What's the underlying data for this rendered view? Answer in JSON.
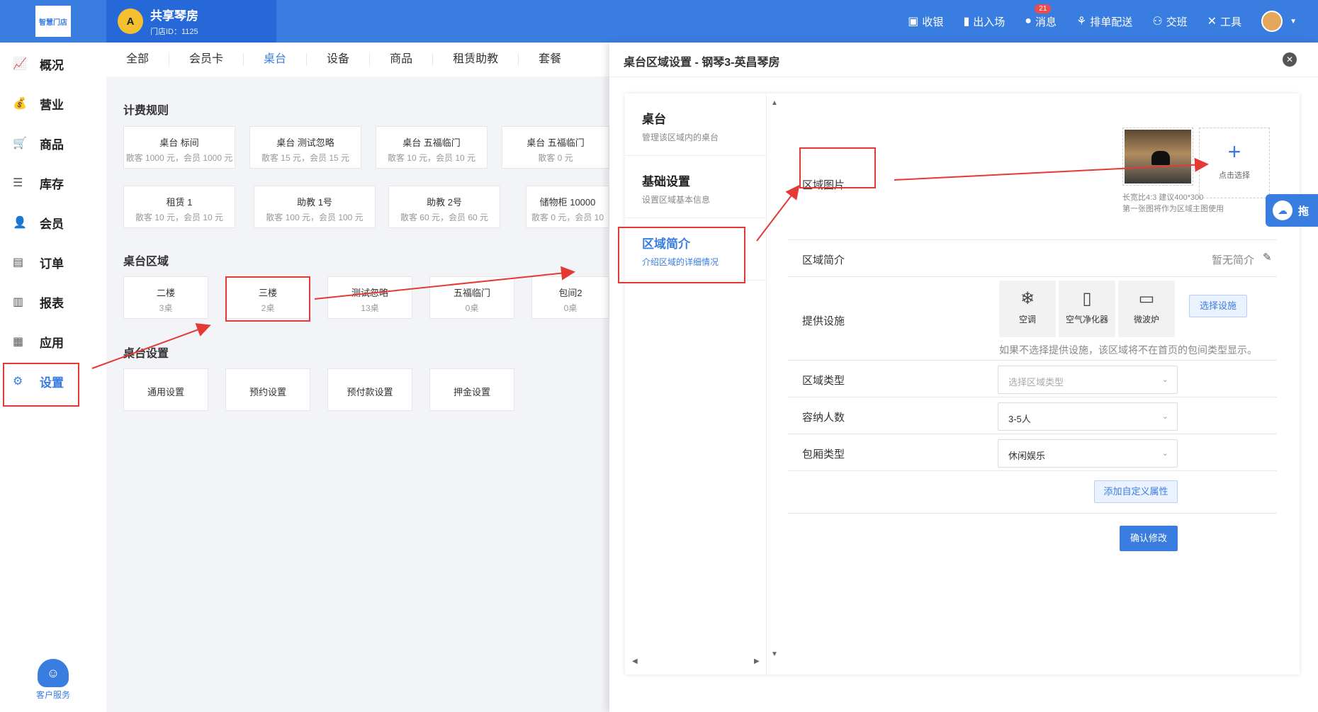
{
  "header": {
    "logo_text": "智慧门店",
    "store_avatar_text": "A",
    "store_name": "共享琴房",
    "store_id": "门店ID：1125",
    "actions": [
      {
        "label": "收银",
        "icon": "cash-register-icon"
      },
      {
        "label": "出入场",
        "icon": "door-icon"
      },
      {
        "label": "消息",
        "icon": "bell-icon"
      },
      {
        "label": "排单配送",
        "icon": "delivery-icon"
      },
      {
        "label": "交班",
        "icon": "shift-handover-icon"
      },
      {
        "label": "工具",
        "icon": "tools-icon"
      }
    ],
    "message_count": "21"
  },
  "sidebar": {
    "items": [
      {
        "label": "概况",
        "icon": "chart-line-icon"
      },
      {
        "label": "营业",
        "icon": "money-bag-icon"
      },
      {
        "label": "商品",
        "icon": "cart-icon"
      },
      {
        "label": "库存",
        "icon": "layers-icon"
      },
      {
        "label": "会员",
        "icon": "user-icon"
      },
      {
        "label": "订单",
        "icon": "order-icon"
      },
      {
        "label": "报表",
        "icon": "bar-chart-icon"
      },
      {
        "label": "应用",
        "icon": "apps-icon"
      },
      {
        "label": "设置",
        "icon": "gear-icon"
      }
    ],
    "active_index": 8,
    "customer_service": "客户服务"
  },
  "main": {
    "tabs": [
      "全部",
      "会员卡",
      "桌台",
      "设备",
      "商品",
      "租赁助教",
      "套餐"
    ],
    "active_tab": "桌台",
    "billing_title": "计费规则",
    "billing_row1": [
      {
        "name": "桌台 标间",
        "price": "散客 1000 元，会员 1000 元"
      },
      {
        "name": "桌台 测试忽略",
        "price": "散客 15 元，会员 15 元"
      },
      {
        "name": "桌台 五福临门",
        "price": "散客 10 元，会员 10 元"
      },
      {
        "name": "桌台 五福临门",
        "price": "散客 0 元"
      }
    ],
    "billing_row2": [
      {
        "name": "租赁 1",
        "price": "散客 10 元，会员 10 元"
      },
      {
        "name": "助教 1号",
        "price": "散客 100 元，会员 100 元"
      },
      {
        "name": "助教 2号",
        "price": "散客 60 元，会员 60 元"
      },
      {
        "name": "储物柜 10000",
        "price": "散客 0 元，会员 10"
      }
    ],
    "area_title": "桌台区域",
    "areas": [
      {
        "name": "二楼",
        "count": "3桌"
      },
      {
        "name": "三楼",
        "count": "2桌"
      },
      {
        "name": "测试忽略",
        "count": "13桌"
      },
      {
        "name": "五福临门",
        "count": "0桌"
      },
      {
        "name": "包间2",
        "count": "0桌"
      }
    ],
    "settings_title": "桌台设置",
    "settings": [
      "通用设置",
      "预约设置",
      "预付款设置",
      "押金设置"
    ]
  },
  "panel": {
    "title": "桌台区域设置 - 钢琴3-英昌琴房",
    "close_icon": "close-icon",
    "subnav": [
      {
        "title": "桌台",
        "desc": "管理该区域内的桌台"
      },
      {
        "title": "基础设置",
        "desc": "设置区域基本信息"
      },
      {
        "title": "区域简介",
        "desc": "介绍区域的详细情况"
      }
    ],
    "active_subnav": 2,
    "form": {
      "image_label": "区域图片",
      "upload_text": "点击选择",
      "image_hint1": "长宽比4:3 建议400*300",
      "image_hint2": "第一张图将作为区域主图使用",
      "intro_label": "区域简介",
      "intro_value": "暂无简介",
      "facilities_label": "提供设施",
      "facilities": [
        {
          "label": "空调",
          "icon": "snowflake-icon",
          "glyph": "❄"
        },
        {
          "label": "空气净化器",
          "icon": "air-purifier-icon",
          "glyph": "▯"
        },
        {
          "label": "微波炉",
          "icon": "microwave-icon",
          "glyph": "▭"
        }
      ],
      "select_facilities_btn": "选择设施",
      "facilities_hint": "如果不选择提供设施，该区域将不在首页的包间类型显示。",
      "area_type_label": "区域类型",
      "area_type_placeholder": "选择区域类型",
      "capacity_label": "容纳人数",
      "capacity_value": "3-5人",
      "room_type_label": "包厢类型",
      "room_type_value": "休闲娱乐",
      "add_attr_btn": "添加自定义属性",
      "confirm_btn": "确认修改"
    }
  },
  "floating_badge": {
    "icon": "cloud-icon",
    "label": "拖"
  },
  "annotation_color": "#e53935",
  "accent_color": "#3a7de0"
}
